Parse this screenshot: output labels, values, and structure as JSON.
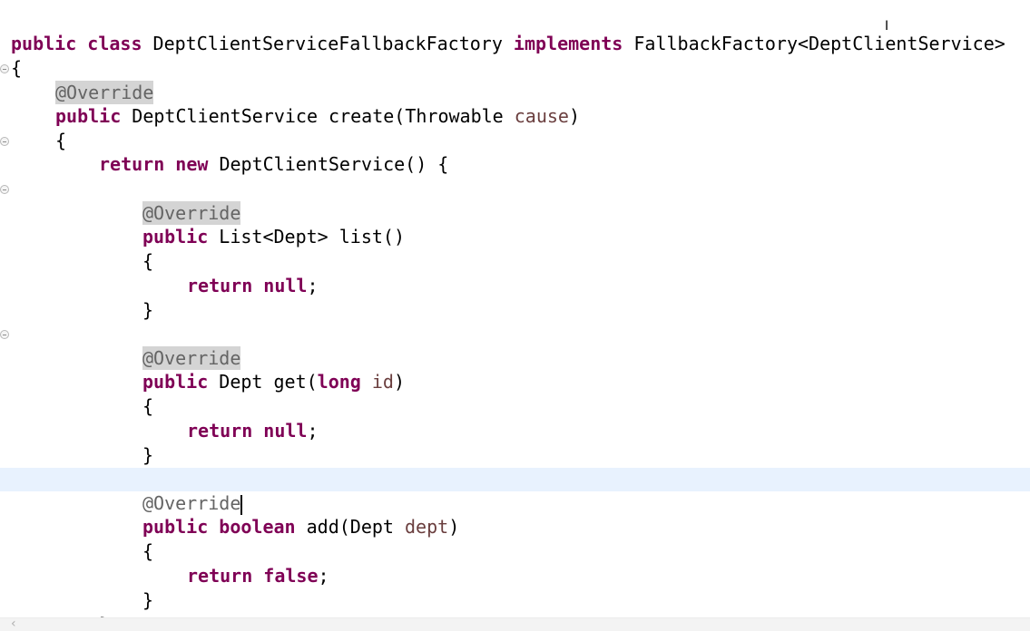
{
  "editor": {
    "language": "java",
    "lines": {
      "l1": {
        "kw1": "public",
        "kw2": "class",
        "name": " DeptClientServiceFallbackFactory ",
        "kw3": "implements",
        "rest": " FallbackFactory<DeptClientService>"
      },
      "l2": {
        "text": "{"
      },
      "l3": {
        "annotation": "@Override"
      },
      "l4": {
        "kw1": "public",
        "mid": " DeptClientService create(Throwable ",
        "param": "cause",
        "end": ")"
      },
      "l5": {
        "text": "{"
      },
      "l6": {
        "kw1": "return",
        "kw2": "new",
        "rest": " DeptClientService() {"
      },
      "l7": {
        "annotation": "@Override"
      },
      "l8": {
        "kw1": "public",
        "rest": " List<Dept> list()"
      },
      "l9": {
        "text": "{"
      },
      "l10": {
        "kw1": "return",
        "kw2": "null",
        "end": ";"
      },
      "l11": {
        "text": "}"
      },
      "l12": {
        "annotation": "@Override"
      },
      "l13": {
        "kw1": "public",
        "mid": " Dept get(",
        "kw2": "long",
        "space": " ",
        "param": "id",
        "end": ")"
      },
      "l14": {
        "text": "{"
      },
      "l15": {
        "kw1": "return",
        "kw2": "null",
        "end": ";"
      },
      "l16": {
        "text": "}"
      },
      "l17": {
        "annotation": "@Override"
      },
      "l18": {
        "kw1": "public",
        "kw2": "boolean",
        "mid": " add(Dept ",
        "param": "dept",
        "end": ")"
      },
      "l19": {
        "text": "{"
      },
      "l20": {
        "kw1": "return",
        "kw2": "false",
        "end": ";"
      },
      "l21": {
        "text": "}"
      },
      "l22": {
        "text": "};"
      }
    },
    "colors": {
      "keyword": "#7f0055",
      "annotation": "#646464",
      "parameter": "#6a3e3e",
      "current_line": "#e8f2fe",
      "annotation_highlight": "#d4d4d4"
    },
    "icons": {
      "fold": "fold-collapse-icon",
      "text_cursor": "i-beam-cursor-icon",
      "scroll_left": "scroll-left-arrow-icon"
    },
    "scroll_left_glyph": "‹",
    "ibeam_glyph": "I"
  }
}
